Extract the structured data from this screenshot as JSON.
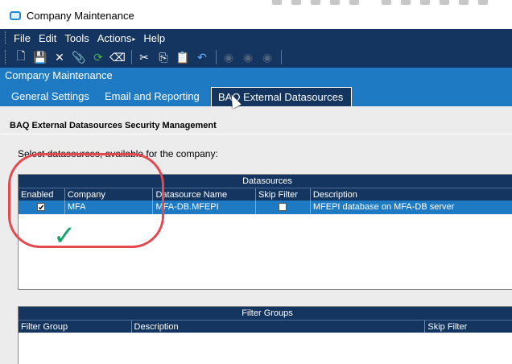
{
  "window": {
    "title": "Company Maintenance"
  },
  "menu": [
    "File",
    "Edit",
    "Tools",
    "Actions",
    "Help"
  ],
  "toolbar": {
    "icons": [
      "new-icon",
      "save-icon",
      "delete-icon",
      "attach-icon",
      "refresh-icon",
      "clear-icon",
      "cut-icon",
      "copy-icon",
      "paste-icon",
      "undo-icon",
      "prev-icon",
      "stop-icon",
      "next-icon"
    ]
  },
  "module_header": "Company Maintenance",
  "tabs": [
    "General Settings",
    "Email and Reporting",
    "BAQ External Datasources"
  ],
  "active_tab": "BAQ External Datasources",
  "section_title": "BAQ External Datasources Security Management",
  "select_label": "Select datasources, available for the company:",
  "datasources": {
    "caption": "Datasources",
    "columns": [
      "Enabled",
      "Company",
      "Datasource Name",
      "Skip Filter",
      "Description"
    ],
    "rows": [
      {
        "enabled": true,
        "company": "MFA",
        "datasource_name": "MFA-DB.MFEPI",
        "skip_filter": false,
        "description": "MFEPI database on MFA-DB server"
      }
    ]
  },
  "filter_groups": {
    "caption": "Filter Groups",
    "columns": [
      "Filter Group",
      "Description",
      "Skip Filter"
    ]
  },
  "colors": {
    "dark_navy": "#14355f",
    "blue": "#1e7ac2",
    "annotation_red": "#e5484d",
    "annotation_green": "#18a36b"
  }
}
